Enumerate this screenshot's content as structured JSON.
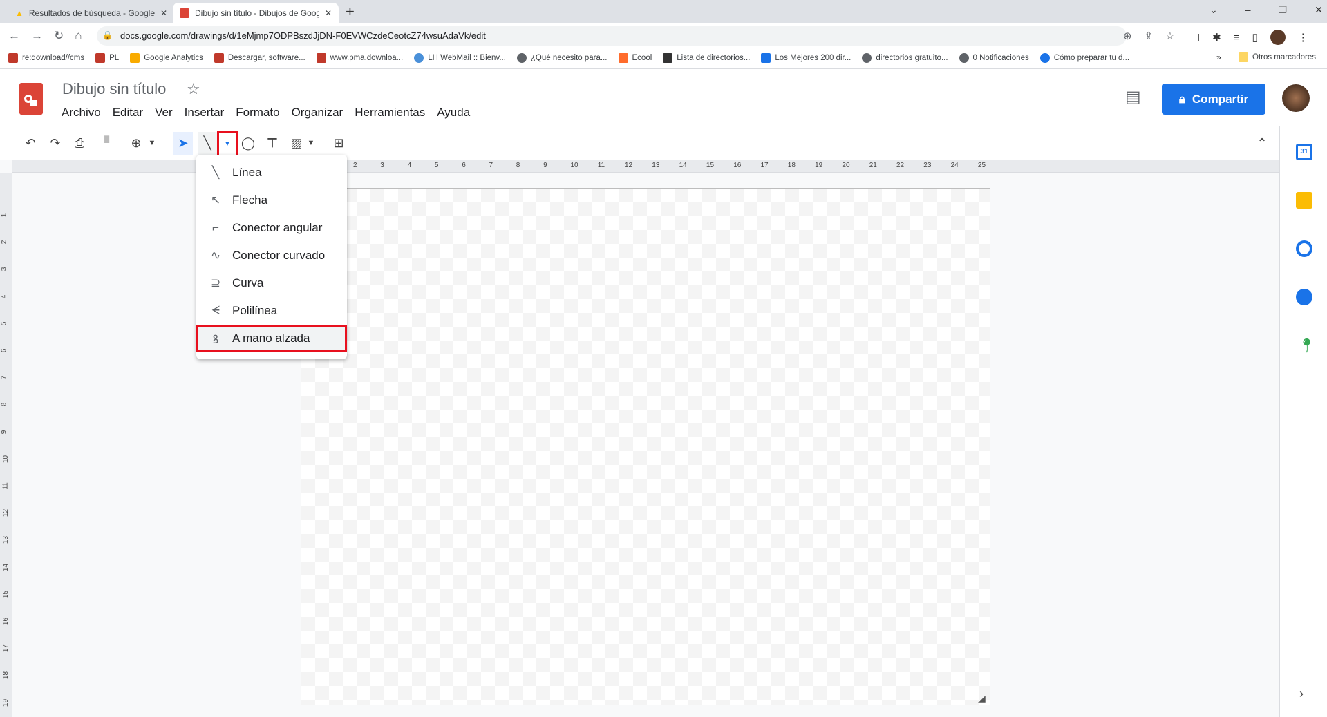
{
  "browser": {
    "tabs": [
      {
        "label": "Resultados de búsqueda - Google Drive",
        "icon": "google-drive-icon"
      },
      {
        "label": "Dibujo sin título - Dibujos de Google",
        "icon": "google-drawings-icon"
      }
    ],
    "url": "docs.google.com/drawings/d/1eMjmp7ODPBszdJjDN-F0EVWCzdeCeotcZ74wsuAdaVk/edit",
    "bookmarks": [
      "re:download//cms",
      "PL",
      "Google Analytics",
      "Descargar, software...",
      "www.pma.downloa...",
      "LH WebMail :: Bienv...",
      "¿Qué necesito para...",
      "Ecool",
      "Lista de directorios...",
      "Los Mejores 200 dir...",
      "directorios gratuito...",
      "0 Notificaciones",
      "Cómo preparar tu d..."
    ],
    "more_bookmarks": "»",
    "other_bookmarks": "Otros marcadores"
  },
  "app": {
    "title": "Dibujo sin título",
    "menus": [
      "Archivo",
      "Editar",
      "Ver",
      "Insertar",
      "Formato",
      "Organizar",
      "Herramientas",
      "Ayuda"
    ],
    "share_label": "Compartir",
    "accent": "#1a73e8"
  },
  "ruler": {
    "top": [
      "2",
      "3",
      "4",
      "5",
      "6",
      "7",
      "8",
      "9",
      "10",
      "11",
      "12",
      "13",
      "14",
      "15",
      "16",
      "17",
      "18",
      "19",
      "20",
      "21",
      "22",
      "23",
      "24",
      "25"
    ],
    "left": [
      "1",
      "2",
      "3",
      "4",
      "5",
      "6",
      "7",
      "8",
      "9",
      "10",
      "11",
      "12",
      "13",
      "14",
      "15",
      "16",
      "17",
      "18",
      "19"
    ]
  },
  "line_menu": {
    "items": [
      {
        "label": "Línea",
        "icon": "line-icon"
      },
      {
        "label": "Flecha",
        "icon": "arrow-icon"
      },
      {
        "label": "Conector angular",
        "icon": "elbow-connector-icon"
      },
      {
        "label": "Conector curvado",
        "icon": "curved-connector-icon"
      },
      {
        "label": "Curva",
        "icon": "curve-icon"
      },
      {
        "label": "Polilínea",
        "icon": "polyline-icon"
      },
      {
        "label": "A mano alzada",
        "icon": "scribble-icon",
        "highlighted": true
      }
    ],
    "highlight_color": "#e8101e"
  }
}
